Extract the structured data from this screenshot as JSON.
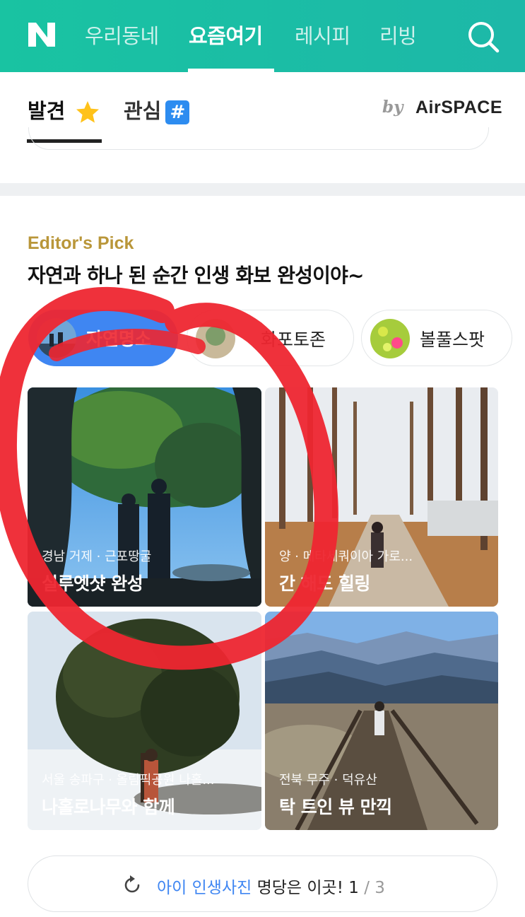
{
  "top_nav": {
    "logo_text": "N",
    "items": [
      {
        "label": "우리동네"
      },
      {
        "label": "요즘여기"
      },
      {
        "label": "레시피"
      },
      {
        "label": "리빙"
      }
    ]
  },
  "sub_tabs": {
    "discover_label": "발견",
    "interest_label": "관심",
    "hash_symbol": "#",
    "by_label": "by",
    "brand_label": "AirSPACE"
  },
  "section": {
    "eyebrow": "Editor's Pick",
    "headline": "자연과 하나 된 순간 인생 화보 완성이야~"
  },
  "chips": [
    {
      "label": "자연명소"
    },
    {
      "label": "화포토존"
    },
    {
      "label": "볼풀스팟"
    }
  ],
  "cards": [
    {
      "location": "경남 거제 · 근포땅굴",
      "title": "실루엣샷 완성"
    },
    {
      "location": "양 · 메타세쿼이아 가로...",
      "title": "간 해도 힐링"
    },
    {
      "location": "서울 송파구 · 올림픽공원 나홀...",
      "title": "나홀로나무와 함께"
    },
    {
      "location": "전북 무주 · 덕유산",
      "title": "탁 트인 뷰 만끽"
    }
  ],
  "pager": {
    "highlight": "아이 인생사진",
    "rest": " 명당은 이곳!",
    "current": "1",
    "separator": "/",
    "total": "3"
  },
  "colors": {
    "header_green": "#19c3a2",
    "accent_blue": "#3f86f2",
    "editor_gold": "#b99639",
    "annotation_red": "#ee2630"
  }
}
